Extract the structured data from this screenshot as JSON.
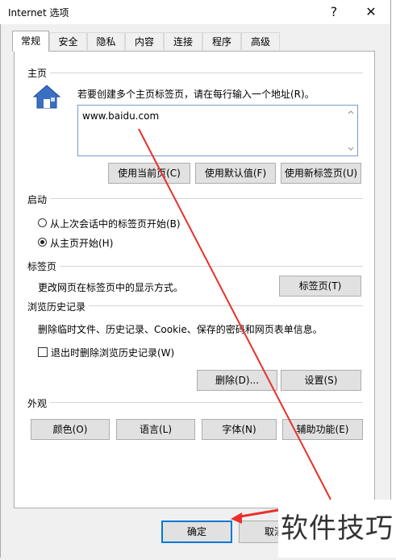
{
  "window": {
    "title": "Internet 选项",
    "help_glyph": "?",
    "close_glyph": "✕"
  },
  "tabs": [
    "常规",
    "安全",
    "隐私",
    "内容",
    "连接",
    "程序",
    "高级"
  ],
  "homepage": {
    "label": "主页",
    "instruction": "若要创建多个主页标签页，请在每行输入一个地址(R)。",
    "value": "www.baidu.com",
    "buttons": [
      "使用当前页(C)",
      "使用默认值(F)",
      "使用新标签页(U)"
    ]
  },
  "startup": {
    "label": "启动",
    "options": [
      "从上次会话中的标签页开始(B)",
      "从主页开始(H)"
    ],
    "selected_index": 1
  },
  "tabs_section": {
    "label": "标签页",
    "description": "更改网页在标签页中的显示方式。",
    "button": "标签页(T)"
  },
  "history": {
    "label": "浏览历史记录",
    "description": "删除临时文件、历史记录、Cookie、保存的密码和网页表单信息。",
    "checkbox_label": "退出时删除浏览历史记录(W)",
    "checkbox_checked": false,
    "buttons": [
      "删除(D)...",
      "设置(S)"
    ]
  },
  "appearance": {
    "label": "外观",
    "buttons": [
      "颜色(O)",
      "语言(L)",
      "字体(N)",
      "辅助功能(E)"
    ]
  },
  "footer": {
    "ok": "确定",
    "cancel": "取消"
  },
  "watermark": "软件技巧",
  "colors": {
    "accent": "#0078d7",
    "annotation": "#e8302a",
    "icon_blue": "#3a6fc4"
  }
}
